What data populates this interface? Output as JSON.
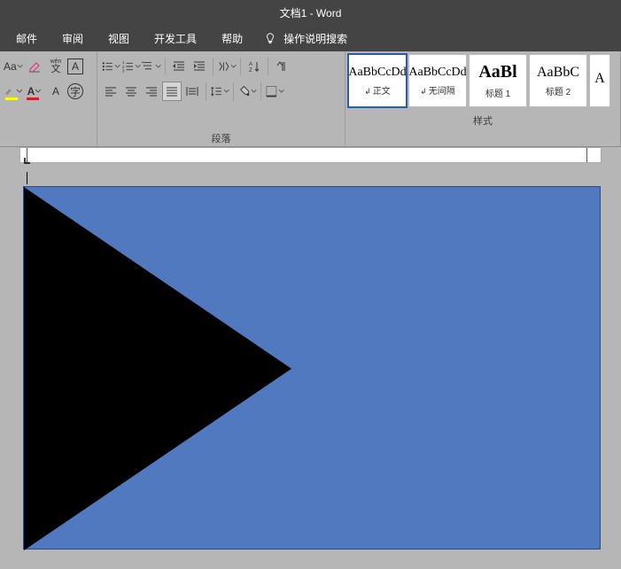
{
  "title": "文档1 - Word",
  "menu": {
    "mail": "邮件",
    "review": "审阅",
    "view": "视图",
    "devtools": "开发工具",
    "help": "帮助",
    "search_hint": "操作说明搜索"
  },
  "ribbon": {
    "font": {
      "label": "",
      "case_btn": "Aa",
      "phonetic": "wén",
      "border_char": "A",
      "char_a": "A",
      "char_circle_a": "A",
      "char_box": "字"
    },
    "paragraph": {
      "label": "段落"
    },
    "styles": {
      "label": "样式",
      "items": [
        {
          "preview": "AaBbCcDd",
          "name": "正文",
          "marker": "↲",
          "cls": "normal",
          "selected": true
        },
        {
          "preview": "AaBbCcDd",
          "name": "无间隔",
          "marker": "↲",
          "cls": "nospacing",
          "selected": false
        },
        {
          "preview": "AaBl",
          "name": "标题 1",
          "marker": "",
          "cls": "heading1",
          "selected": false
        },
        {
          "preview": "AaBbC",
          "name": "标题 2",
          "marker": "",
          "cls": "heading2",
          "selected": false
        },
        {
          "preview": "A",
          "name": "",
          "marker": "",
          "cls": "heading2",
          "selected": false
        }
      ]
    }
  },
  "colors": {
    "accent": "#5079bf",
    "highlight": "#ffff00",
    "font_red": "#d02424",
    "ribbon_bg": "#b6b6b6",
    "dark_bg": "#444444"
  }
}
